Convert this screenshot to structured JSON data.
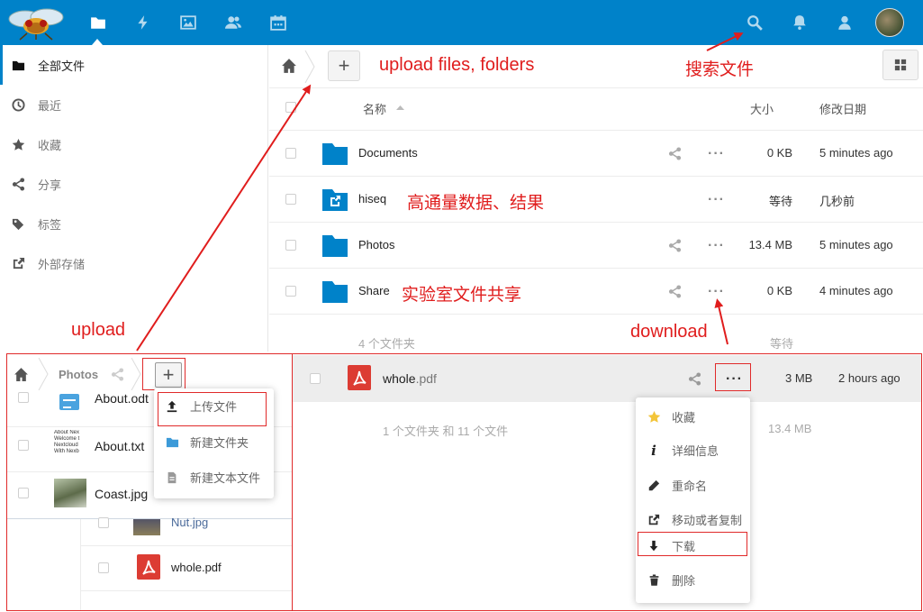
{
  "header": {
    "nav_icons": [
      "files-icon",
      "activity-icon",
      "gallery-icon",
      "contacts-icon",
      "calendar-icon"
    ],
    "right_icons": [
      "search-icon",
      "notifications-icon",
      "contacts-menu-icon"
    ],
    "accent_color": "#0082c9"
  },
  "sidebar": {
    "items": [
      {
        "label": "全部文件",
        "icon": "folder-icon"
      },
      {
        "label": "最近",
        "icon": "clock-icon"
      },
      {
        "label": "收藏",
        "icon": "star-icon"
      },
      {
        "label": "分享",
        "icon": "share-icon"
      },
      {
        "label": "标签",
        "icon": "tag-icon"
      },
      {
        "label": "外部存储",
        "icon": "external-icon"
      }
    ]
  },
  "file_table": {
    "columns": {
      "name": "名称",
      "size": "大小",
      "modified": "修改日期"
    },
    "rows": [
      {
        "name": "Documents",
        "size": "0 KB",
        "modified": "5 minutes ago"
      },
      {
        "name": "hiseq",
        "size": "等待",
        "modified": "几秒前"
      },
      {
        "name": "Photos",
        "size": "13.4 MB",
        "modified": "5 minutes ago"
      },
      {
        "name": "Share",
        "size": "0 KB",
        "modified": "4 minutes ago"
      }
    ],
    "summary": "4 个文件夹",
    "summary_size": "等待"
  },
  "annotations": {
    "upload_files": "upload files, folders",
    "search_files": "搜索文件",
    "hiseq_note": "高通量数据、结果",
    "share_note": "实验室文件共享",
    "upload": "upload",
    "download": "download"
  },
  "upload_panel": {
    "breadcrumb": "Photos",
    "files": [
      "About.odt",
      "About.txt",
      "Coast.jpg",
      "Nut.jpg",
      "whole.pdf"
    ],
    "thumb_text": [
      "About Nex",
      "Welcome t",
      "Nextcloud",
      "With Nexb"
    ],
    "menu": [
      "上传文件",
      "新建文件夹",
      "新建文本文件"
    ]
  },
  "download_panel": {
    "file": {
      "name": "whole",
      "ext": ".pdf",
      "size": "3 MB",
      "modified": "2 hours ago"
    },
    "summary": "1 个文件夹 和 11 个文件",
    "summary_size": "13.4 MB",
    "menu": [
      "收藏",
      "详细信息",
      "重命名",
      "移动或者复制",
      "下载",
      "删除"
    ]
  }
}
